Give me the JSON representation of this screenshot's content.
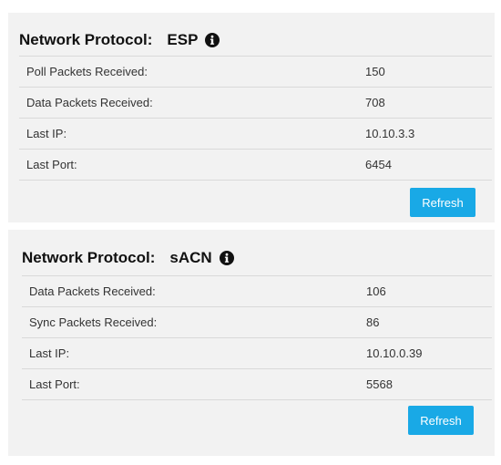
{
  "panels": [
    {
      "title_label": "Network Protocol:",
      "protocol": "ESP",
      "info_icon": "info-circle-icon",
      "rows": [
        {
          "label": "Poll Packets Received:",
          "value": "150"
        },
        {
          "label": "Data Packets Received:",
          "value": "708"
        },
        {
          "label": "Last IP:",
          "value": "10.10.3.3"
        },
        {
          "label": "Last Port:",
          "value": "6454"
        }
      ],
      "refresh_label": "Refresh"
    },
    {
      "title_label": "Network Protocol:",
      "protocol": "sACN",
      "info_icon": "info-circle-icon",
      "rows": [
        {
          "label": "Data Packets Received:",
          "value": "106"
        },
        {
          "label": "Sync Packets Received:",
          "value": "86"
        },
        {
          "label": "Last IP:",
          "value": "10.10.0.39"
        },
        {
          "label": "Last Port:",
          "value": "5568"
        }
      ],
      "refresh_label": "Refresh"
    }
  ],
  "colors": {
    "panel_background": "#f2f2f2",
    "button_accent": "#19a9e6",
    "divider": "#d9d9d9"
  }
}
